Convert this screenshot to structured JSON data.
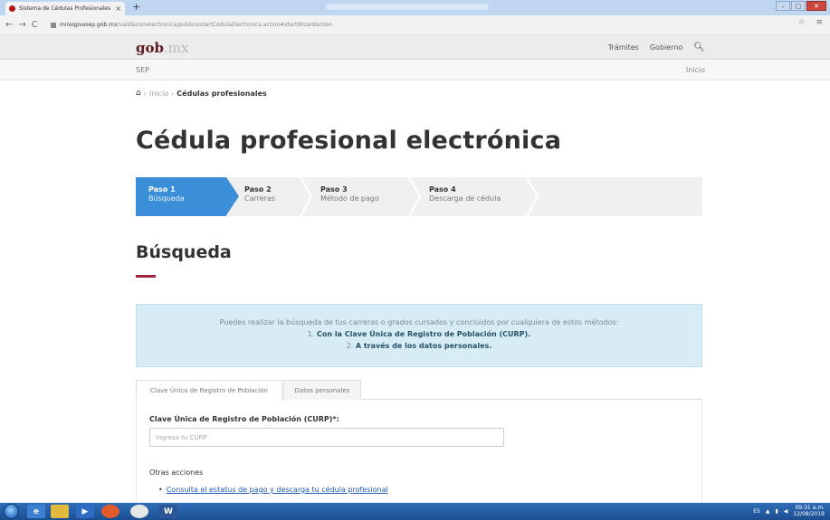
{
  "browser": {
    "tab_title": "Sistema de Cédulas Profesionales",
    "tab_close": "×",
    "new_tab": "+",
    "window_buttons": [
      "–",
      "▢",
      "✕"
    ],
    "nav": [
      "←",
      "→",
      "C"
    ],
    "url_host": "mireqpvesep.gob.mx",
    "url_path": "/validacionelectronica/publico/startCedulaElectronica.action#startWizardaction",
    "toolbar_icons": [
      "☆",
      "≡"
    ]
  },
  "header": {
    "logo_main": "gob",
    "logo_tld": ".mx",
    "links": [
      "Trámites",
      "Gobierno"
    ],
    "search_icon": "search-icon",
    "sub_brand": "SEP",
    "inicio": "Inicio"
  },
  "breadcrumb": {
    "items": [
      "Inicio",
      "Cédulas profesionales"
    ]
  },
  "page_title": "Cédula profesional electrónica",
  "steps": [
    {
      "number": "Paso 1",
      "label": "Búsqueda",
      "active": true
    },
    {
      "number": "Paso 2",
      "label": "Carreras",
      "active": false
    },
    {
      "number": "Paso 3",
      "label": "Método de pago",
      "active": false
    },
    {
      "number": "Paso 4",
      "label": "Descarga de cédula",
      "active": false
    }
  ],
  "section_title": "Búsqueda",
  "info": {
    "intro": "Puedes realizar la búsqueda de tus carreras o grados cursados y concluidos por cualquiera de estos métodos:",
    "method1_num": "1.",
    "method1": "Con la Clave Única de Registro de Población (CURP).",
    "method2_num": "2.",
    "method2": "A través de los datos personales."
  },
  "form_tabs": [
    "Clave Única de Registro de Población",
    "Datos personales"
  ],
  "form": {
    "curp_label": "Clave Única de Registro de Población (CURP)*:",
    "curp_placeholder": "Ingresa tu CURP",
    "curp_value": ""
  },
  "otras": {
    "title": "Otras acciones",
    "link": "Consulta el estatus de pago y descarga tu cédula profesional"
  },
  "taskbar": {
    "word_icon": "W",
    "lang": "ES",
    "time": "09:31 a.m.",
    "date": "12/08/2019"
  }
}
